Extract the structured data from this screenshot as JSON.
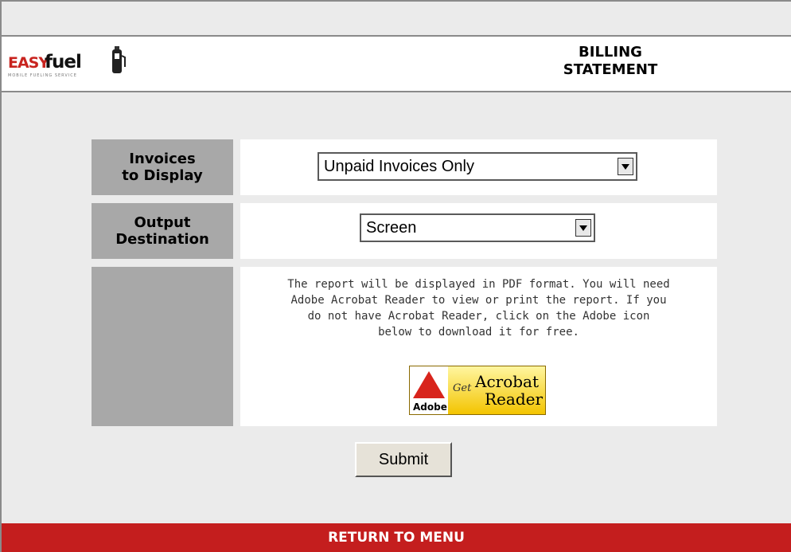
{
  "header": {
    "logo": {
      "easy": "EASY",
      "fuel": "fuel",
      "tagline": "MOBILE FUELING SERVICE"
    },
    "title_line1": "BILLING",
    "title_line2": "STATEMENT"
  },
  "form": {
    "invoices_label_line1": "Invoices",
    "invoices_label_line2": "to Display",
    "invoices_selected": "Unpaid Invoices Only",
    "output_label_line1": "Output",
    "output_label_line2": "Destination",
    "output_selected": "Screen",
    "note_lines": [
      "The report will be displayed in PDF format. You will need",
      "Adobe Acrobat Reader to view or print the report. If you",
      "do not have Acrobat Reader, click on the Adobe icon",
      "below to download it for free."
    ],
    "adobe_badge": {
      "brand": "Adobe",
      "get": "Get",
      "acrobat": "Acrobat",
      "reader": "Reader"
    },
    "submit_label": "Submit"
  },
  "footer": {
    "return_label": "RETURN TO MENU"
  },
  "colors": {
    "footer_bg": "#c41e1e",
    "label_bg": "#a8a8a8",
    "page_bg": "#ebebeb",
    "logo_red": "#c8241f"
  },
  "icons": {
    "select_arrow": "chevron-down-icon",
    "adobe": "adobe-reader-icon",
    "pump": "fuel-pump-icon"
  }
}
